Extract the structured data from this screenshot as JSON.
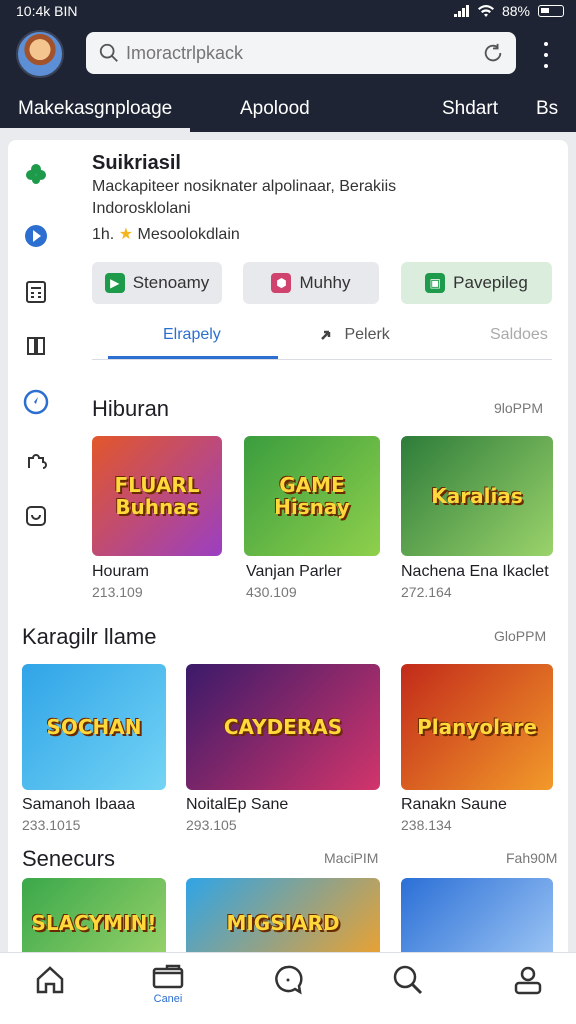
{
  "status_bar": {
    "time": "10:4k BIN",
    "battery": "88%"
  },
  "search": {
    "placeholder": "Imoractrlpkack"
  },
  "top_tabs": [
    "Makekasgnploage",
    "Apolood",
    "Shdart",
    "Bs"
  ],
  "app": {
    "title": "Suikriasil",
    "description": "Mackapiteer nosiknater alpolinaar, Berakiis Indorosklolani",
    "rating_prefix": "1h.",
    "rating_label": "Mesoolokdlain"
  },
  "action_buttons": [
    {
      "label": "Stenoamy",
      "color": "#1e9a4b"
    },
    {
      "label": "Muhhy",
      "color": "#d0436f"
    },
    {
      "label": "Pavepileg",
      "color": "#1e9a4b"
    }
  ],
  "sub_tabs": [
    "Elrapely",
    "Pelerk",
    "Saldoes"
  ],
  "sections": [
    {
      "title": "Hiburan",
      "more": "9loPPM",
      "items": [
        {
          "art": "FLUARL Buhnas",
          "name": "Houram",
          "downloads": "213.109"
        },
        {
          "art": "GAME Hisnay",
          "name": "Vanjan Parler",
          "downloads": "430.109"
        },
        {
          "art": "Karalias",
          "name": "Nachena Ena Ikaclet",
          "downloads": "272.164"
        }
      ]
    },
    {
      "title": "Karagilr llame",
      "more": "GloPPM",
      "items": [
        {
          "art": "SOCHAN",
          "name": "Samanoh Ibaaa",
          "downloads": "233.1015"
        },
        {
          "art": "CAYDERAS",
          "name": "NoitalEp Sane",
          "downloads": "293.105"
        },
        {
          "art": "Planyolare",
          "name": "Ranakn Saune",
          "downloads": "238.134"
        }
      ]
    },
    {
      "title": "Senecurs",
      "more": "MaciPIM",
      "more2": "Fah90M",
      "items": [
        {
          "art": "SLACYMIN!"
        },
        {
          "art": "MIGSIARD"
        },
        {
          "art": ""
        }
      ]
    }
  ],
  "bottom_nav": {
    "active_label": "Canei"
  },
  "colors": {
    "header": "#1e2433",
    "accent": "#2d6fd0"
  }
}
